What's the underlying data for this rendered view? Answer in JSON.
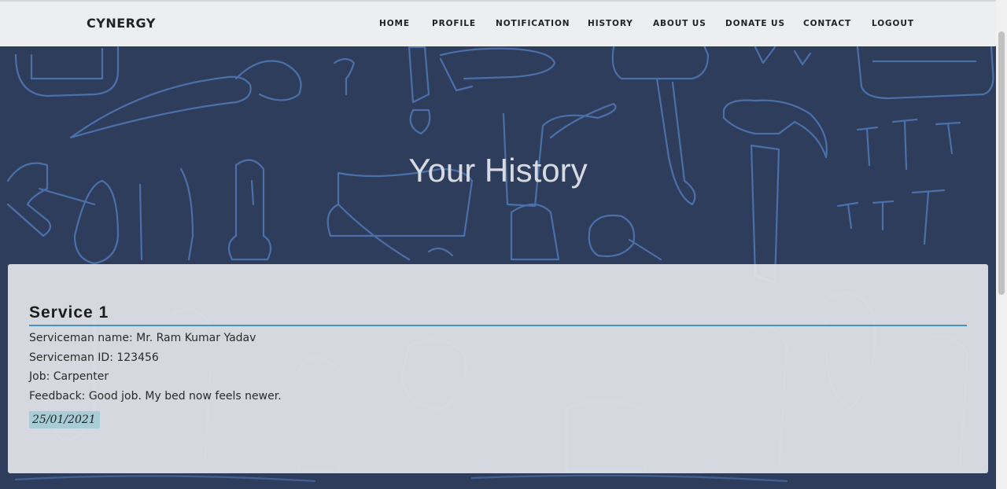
{
  "navbar": {
    "brand": "CYNERGY",
    "links": [
      "HOME",
      "PROFILE",
      "NOTIFICATION",
      "HISTORY",
      "ABOUT US",
      "DONATE US",
      "CONTACT",
      "LOGOUT"
    ]
  },
  "hero": {
    "title": "Your History"
  },
  "service": {
    "title": "Service 1",
    "serviceman_name": "Serviceman name: Mr. Ram Kumar Yadav",
    "serviceman_id": "Serviceman ID: 123456",
    "job": "Job: Carpenter",
    "feedback": "Feedback: Good job. My bed now feels newer.",
    "date": "25/01/2021"
  },
  "colors": {
    "background": "#2f3d5c",
    "sketch_lines": "#4f7ab8",
    "navbar": "#eceeef",
    "accent_rule": "#4a90c8",
    "date_badge": "#a9cdd6"
  }
}
